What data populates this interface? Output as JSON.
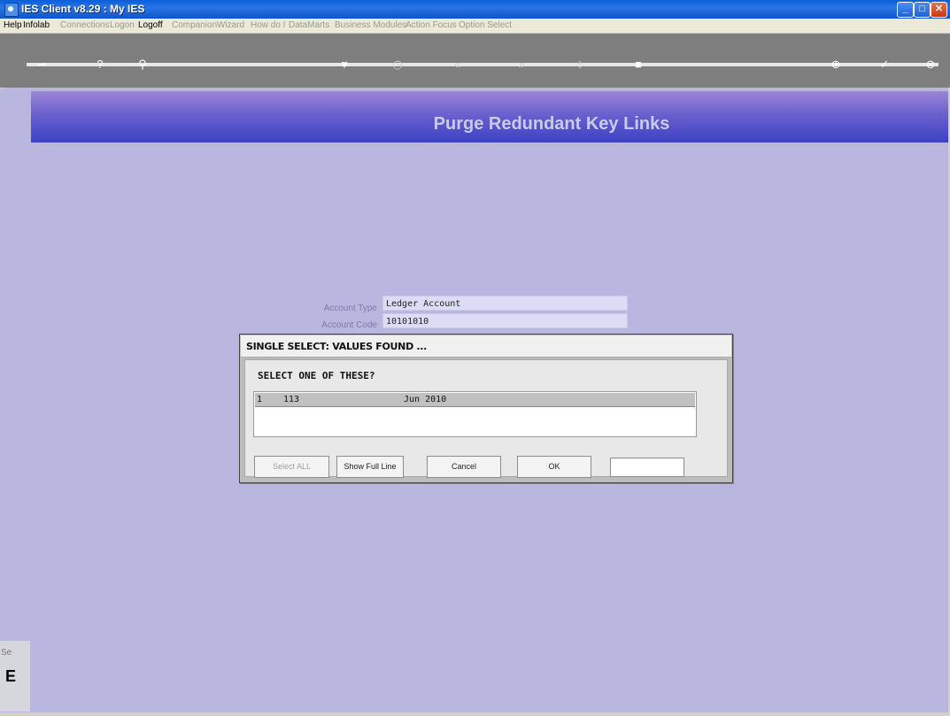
{
  "window": {
    "title": "IES Client v8.29 : My IES",
    "min_glyph": "_",
    "max_glyph": "□",
    "close_glyph": "✕"
  },
  "menu": {
    "items": [
      {
        "label": "Help",
        "enabled": true
      },
      {
        "label": "Infolab",
        "enabled": true
      },
      {
        "label": "Connections",
        "enabled": false
      },
      {
        "label": "Logon",
        "enabled": false
      },
      {
        "label": "Logoff",
        "enabled": true
      },
      {
        "label": "Companion",
        "enabled": false
      },
      {
        "label": "Wizard",
        "enabled": false
      },
      {
        "label": "How do I",
        "enabled": false
      },
      {
        "label": "DataMarts",
        "enabled": false
      },
      {
        "label": "Business Modules",
        "enabled": false
      },
      {
        "label": "Action Focus",
        "enabled": false
      },
      {
        "label": "Option Select",
        "enabled": false
      }
    ]
  },
  "toolbar": {
    "icons": [
      {
        "name": "key-icon",
        "glyph": "⊸"
      },
      {
        "name": "help-icon",
        "glyph": "?"
      },
      {
        "name": "search-icon",
        "glyph": "⚲"
      },
      {
        "name": "heart-icon",
        "glyph": "♥"
      },
      {
        "name": "clock-icon",
        "glyph": "◷"
      },
      {
        "name": "back-icon",
        "glyph": "«"
      },
      {
        "name": "forward-icon",
        "glyph": "»"
      },
      {
        "name": "save-icon",
        "glyph": "⎀"
      },
      {
        "name": "stop-icon",
        "glyph": "■"
      },
      {
        "name": "add-icon",
        "glyph": "⊕"
      },
      {
        "name": "check-icon",
        "glyph": "✓"
      },
      {
        "name": "close-icon",
        "glyph": "⊗"
      }
    ]
  },
  "page": {
    "title": "Purge Redundant Key Links"
  },
  "form": {
    "account_type_label": "Account Type",
    "account_type_value": "Ledger Account",
    "account_code_label": "Account Code",
    "account_code_value": "10101010"
  },
  "dialog": {
    "title": "SINGLE SELECT: VALUES FOUND ...",
    "prompt": "SELECT ONE OF THESE?",
    "rows": [
      {
        "index": "1",
        "code": "113",
        "period": "Jun 2010"
      }
    ],
    "buttons": {
      "select_all": "Select ALL",
      "show_full_line": "Show Full Line",
      "cancel": "Cancel",
      "ok": "OK"
    },
    "input_value": ""
  },
  "side": {
    "label": "Se",
    "glyph": "E"
  },
  "colors": {
    "canvas": "#b9b7e0",
    "banner_start": "#9c86d6",
    "banner_end": "#3c42c4",
    "banner_text": "#c9cbe8"
  }
}
